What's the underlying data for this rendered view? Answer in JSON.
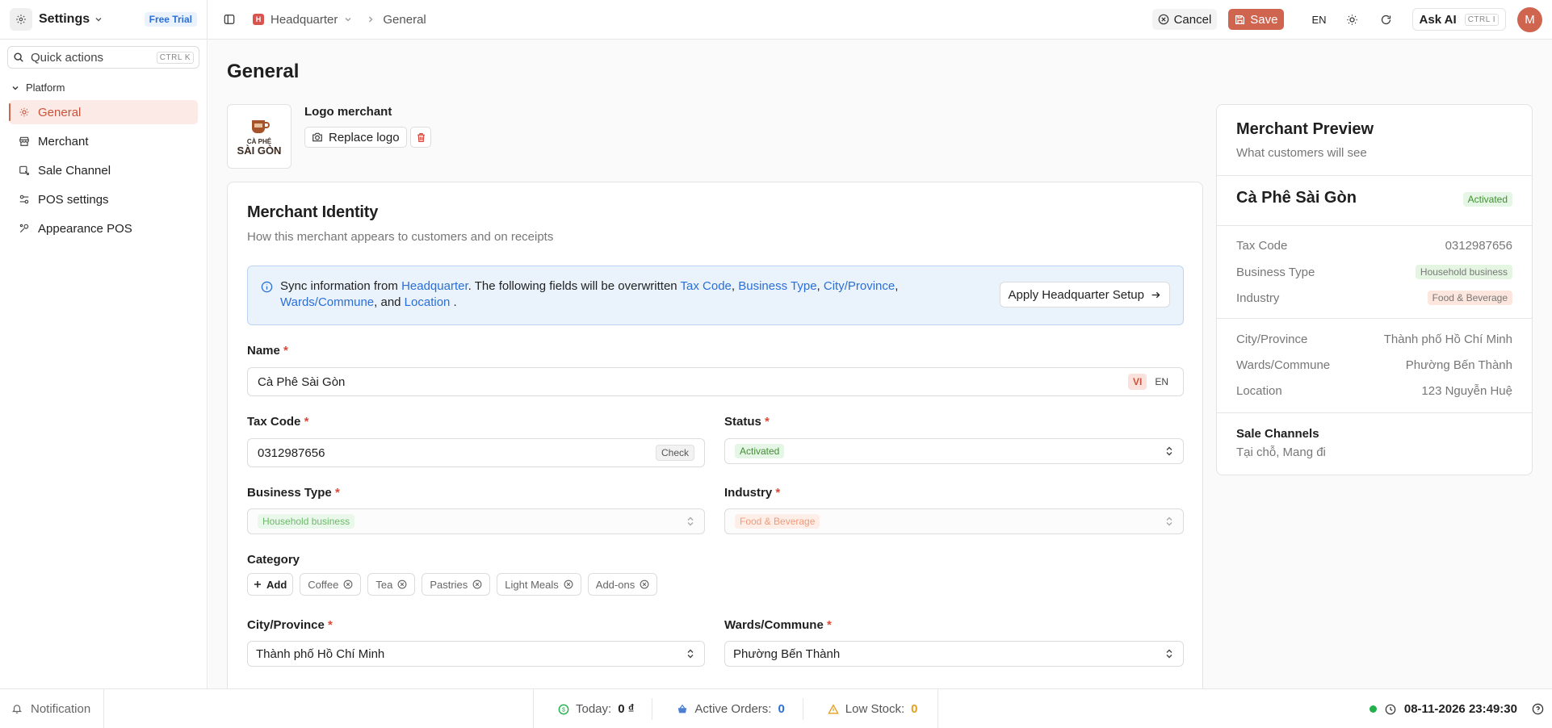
{
  "app": {
    "title": "Settings",
    "trial_badge": "Free Trial"
  },
  "breadcrumb": {
    "org_initial": "H",
    "org": "Headquarter",
    "page": "General"
  },
  "topbar": {
    "cancel": "Cancel",
    "save": "Save",
    "lang": "EN",
    "ask_ai": "Ask AI",
    "ask_ai_kbd": "CTRL I",
    "avatar_initial": "M"
  },
  "sidebar": {
    "quick_actions": "Quick actions",
    "quick_kbd": "CTRL K",
    "group": "Platform",
    "items": [
      {
        "label": "General",
        "icon": "sun-gear-icon",
        "active": true
      },
      {
        "label": "Merchant",
        "icon": "store-icon"
      },
      {
        "label": "Sale Channel",
        "icon": "channel-icon"
      },
      {
        "label": "POS settings",
        "icon": "sliders-icon"
      },
      {
        "label": "Appearance POS",
        "icon": "palette-icon"
      }
    ]
  },
  "page": {
    "title": "General"
  },
  "logo": {
    "label": "Logo merchant",
    "replace": "Replace logo",
    "brand_line1": "CÀ PHÊ",
    "brand_line2": "SÀI GÒN"
  },
  "identity": {
    "title": "Merchant Identity",
    "subtitle": "How this merchant appears to customers and on receipts",
    "sync": {
      "t1": "Sync information from ",
      "link_hq": "Headquarter",
      "t2": ". The following fields will be overwritten ",
      "f1": "Tax Code",
      "c1": ", ",
      "f2": "Business Type",
      "c2": ", ",
      "f3": "City/Province",
      "c3": ", ",
      "f4": "Wards/Commune",
      "c4": ", and ",
      "f5": "Location",
      "t3": " .",
      "apply": "Apply Headquarter Setup"
    },
    "name_label": "Name",
    "name_value": "Cà Phê Sài Gòn",
    "lang_vi": "VI",
    "lang_en": "EN",
    "tax_label": "Tax Code",
    "tax_value": "0312987656",
    "tax_check": "Check",
    "status_label": "Status",
    "status_value": "Activated",
    "btype_label": "Business Type",
    "btype_value": "Household business",
    "industry_label": "Industry",
    "industry_value": "Food & Beverage",
    "category_label": "Category",
    "add": "Add",
    "categories": [
      "Coffee",
      "Tea",
      "Pastries",
      "Light Meals",
      "Add-ons"
    ],
    "city_label": "City/Province",
    "city_value": "Thành phố Hồ Chí Minh",
    "ward_label": "Wards/Commune",
    "ward_value": "Phường Bến Thành",
    "required": "*"
  },
  "preview": {
    "title": "Merchant Preview",
    "subtitle": "What customers will see",
    "name": "Cà Phê Sài Gòn",
    "status": "Activated",
    "tax_label": "Tax Code",
    "tax_value": "0312987656",
    "btype_label": "Business Type",
    "btype_value": "Household business",
    "industry_label": "Industry",
    "industry_value": "Food & Beverage",
    "city_label": "City/Province",
    "city_value": "Thành phố Hồ Chí Minh",
    "ward_label": "Wards/Commune",
    "ward_value": "Phường Bến Thành",
    "loc_label": "Location",
    "loc_value": "123 Nguyễn Huệ",
    "sc_label": "Sale Channels",
    "sc_value": "Tại chỗ, Mang đi"
  },
  "footer": {
    "notification": "Notification",
    "today_label": "Today:",
    "today_value": "0 ₫",
    "orders_label": "Active Orders:",
    "orders_value": "0",
    "stock_label": "Low Stock:",
    "stock_value": "0",
    "datetime": "08-11-2026 23:49:30"
  },
  "colors": {
    "accent": "#d0654f",
    "link": "#2b6fd6",
    "success": "#21b04b"
  }
}
